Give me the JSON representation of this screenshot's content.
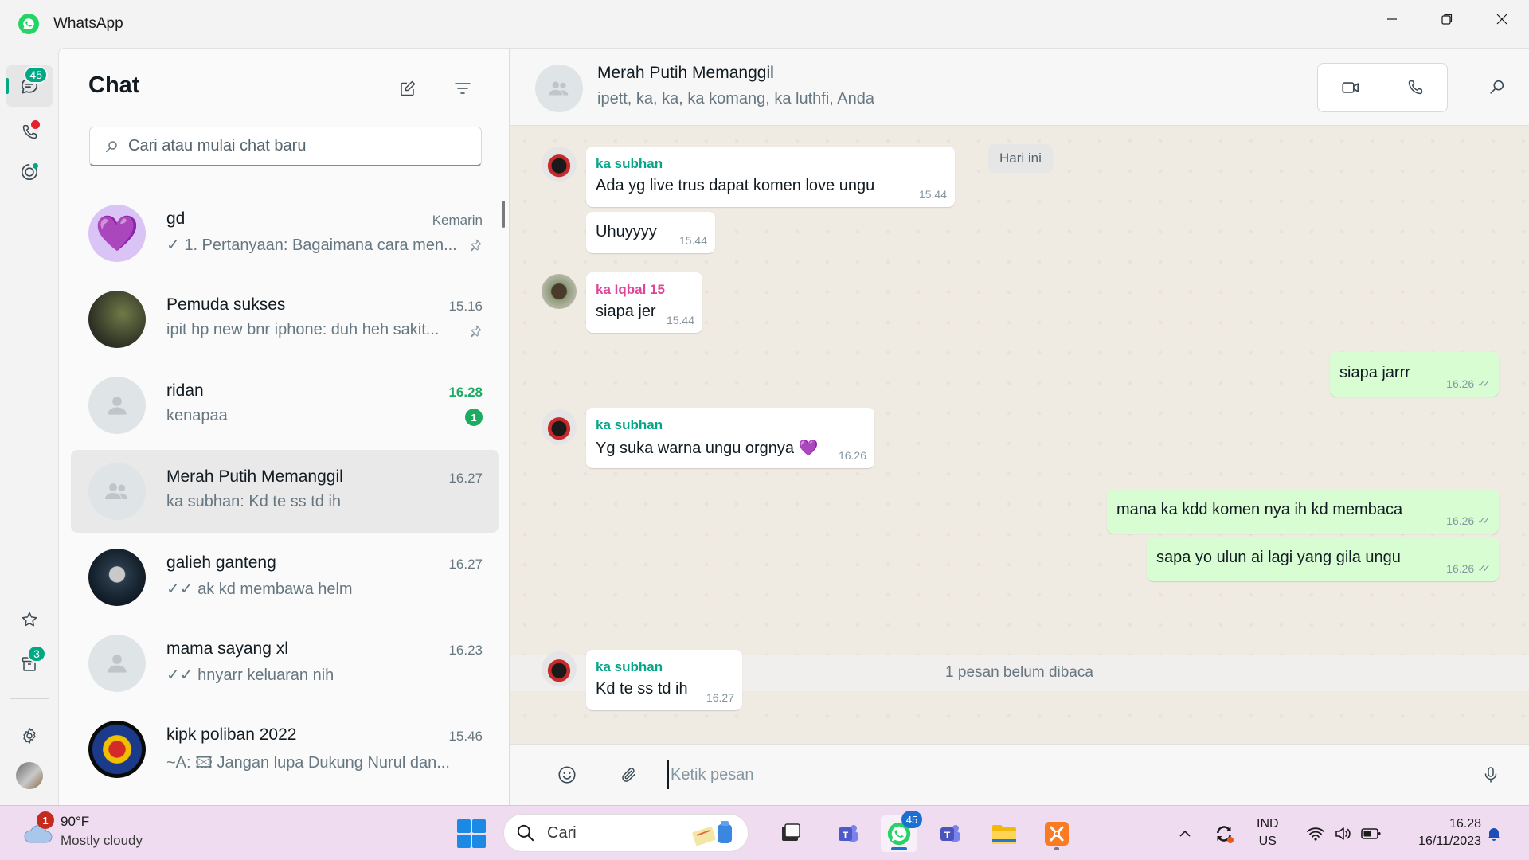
{
  "window": {
    "title": "WhatsApp"
  },
  "rail": {
    "chats_badge": "45",
    "archived_badge": "3"
  },
  "list": {
    "title": "Chat",
    "search_placeholder": "Cari atau mulai chat baru",
    "chats": [
      {
        "name": "gd",
        "time": "Kemarin",
        "preview": "✓ 1. Pertanyaan: Bagaimana cara men...",
        "pinned": true
      },
      {
        "name": "Pemuda sukses",
        "time": "15.16",
        "preview": "ipit hp new bnr iphone: duh heh sakit...",
        "pinned": true
      },
      {
        "name": "ridan",
        "time": "16.28",
        "preview": "kenapaa",
        "unread": "1"
      },
      {
        "name": "Merah Putih Memanggil",
        "time": "16.27",
        "preview": "ka subhan: Kd te ss td ih"
      },
      {
        "name": "galieh ganteng",
        "time": "16.27",
        "preview": "✓✓ ak kd membawa helm"
      },
      {
        "name": "mama sayang xl",
        "time": "16.23",
        "preview": "✓✓ hnyarr keluaran nih"
      },
      {
        "name": "kipk poliban 2022",
        "time": "15.46",
        "preview": "~A: 🖾 Jangan lupa Dukung Nurul dan..."
      }
    ]
  },
  "conversation": {
    "name": "Merah Putih Memanggil",
    "members": "ipett, ka, ka, ka komang, ka luthfi, Anda",
    "date_chip": "Hari ini",
    "unread_divider": "1 pesan belum dibaca",
    "messages": [
      {
        "sender": "ka subhan",
        "text": "Ada yg live trus dapat komen love ungu",
        "time": "15.44"
      },
      {
        "text": "Uhuyyyy",
        "time": "15.44"
      },
      {
        "sender": "ka Iqbal 15",
        "text": "siapa jer",
        "time": "15.44"
      },
      {
        "text": "siapa jarrr",
        "time": "16.26",
        "outgoing": true
      },
      {
        "sender": "ka subhan",
        "text": "Yg suka warna ungu orgnya 💜",
        "time": "16.26"
      },
      {
        "text": "mana ka kdd komen nya ih kd membaca",
        "time": "16.26",
        "outgoing": true
      },
      {
        "text": "sapa yo ulun ai lagi yang gila ungu",
        "time": "16.26",
        "outgoing": true
      },
      {
        "sender": "ka subhan",
        "text": "Kd te ss td ih",
        "time": "16.27"
      }
    ],
    "composer_placeholder": "Ketik pesan"
  },
  "taskbar": {
    "weather_temp": "90°F",
    "weather_desc": "Mostly cloudy",
    "weather_badge": "1",
    "search_label": "Cari",
    "whatsapp_badge": "45",
    "lang_line1": "IND",
    "lang_line2": "US",
    "clock_time": "16.28",
    "clock_date": "16/11/2023"
  },
  "colors": {
    "accent": "#00a884",
    "outgoing_bubble": "#d9fdd3",
    "chat_bg": "#efeae2",
    "taskbar": "#f0dcf0"
  }
}
